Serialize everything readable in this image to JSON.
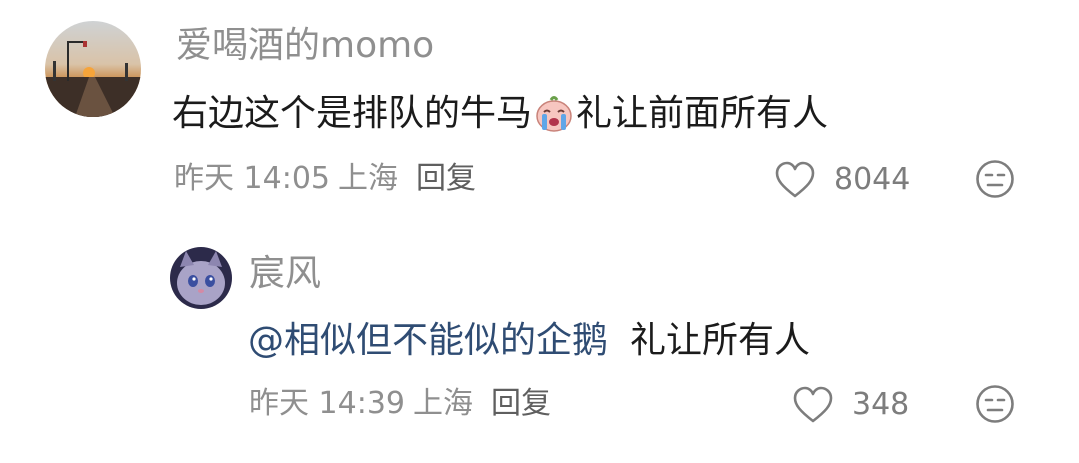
{
  "comments": [
    {
      "username": "爱喝酒的momo",
      "text_before": "右边这个是排队的牛马",
      "emoji": "crying-face-emoji",
      "text_after": "礼让前面所有人",
      "time": "昨天 14:05",
      "location": "上海",
      "reply_label": "回复",
      "likes": "8044"
    },
    {
      "username": "宸风",
      "mention": "@相似但不能似的企鹅",
      "text": "礼让所有人",
      "time": "昨天 14:39",
      "location": "上海",
      "reply_label": "回复",
      "likes": "348"
    }
  ],
  "colors": {
    "username": "#8f8f8f",
    "mention": "#2f4c73",
    "meta": "#8f8f8f"
  }
}
